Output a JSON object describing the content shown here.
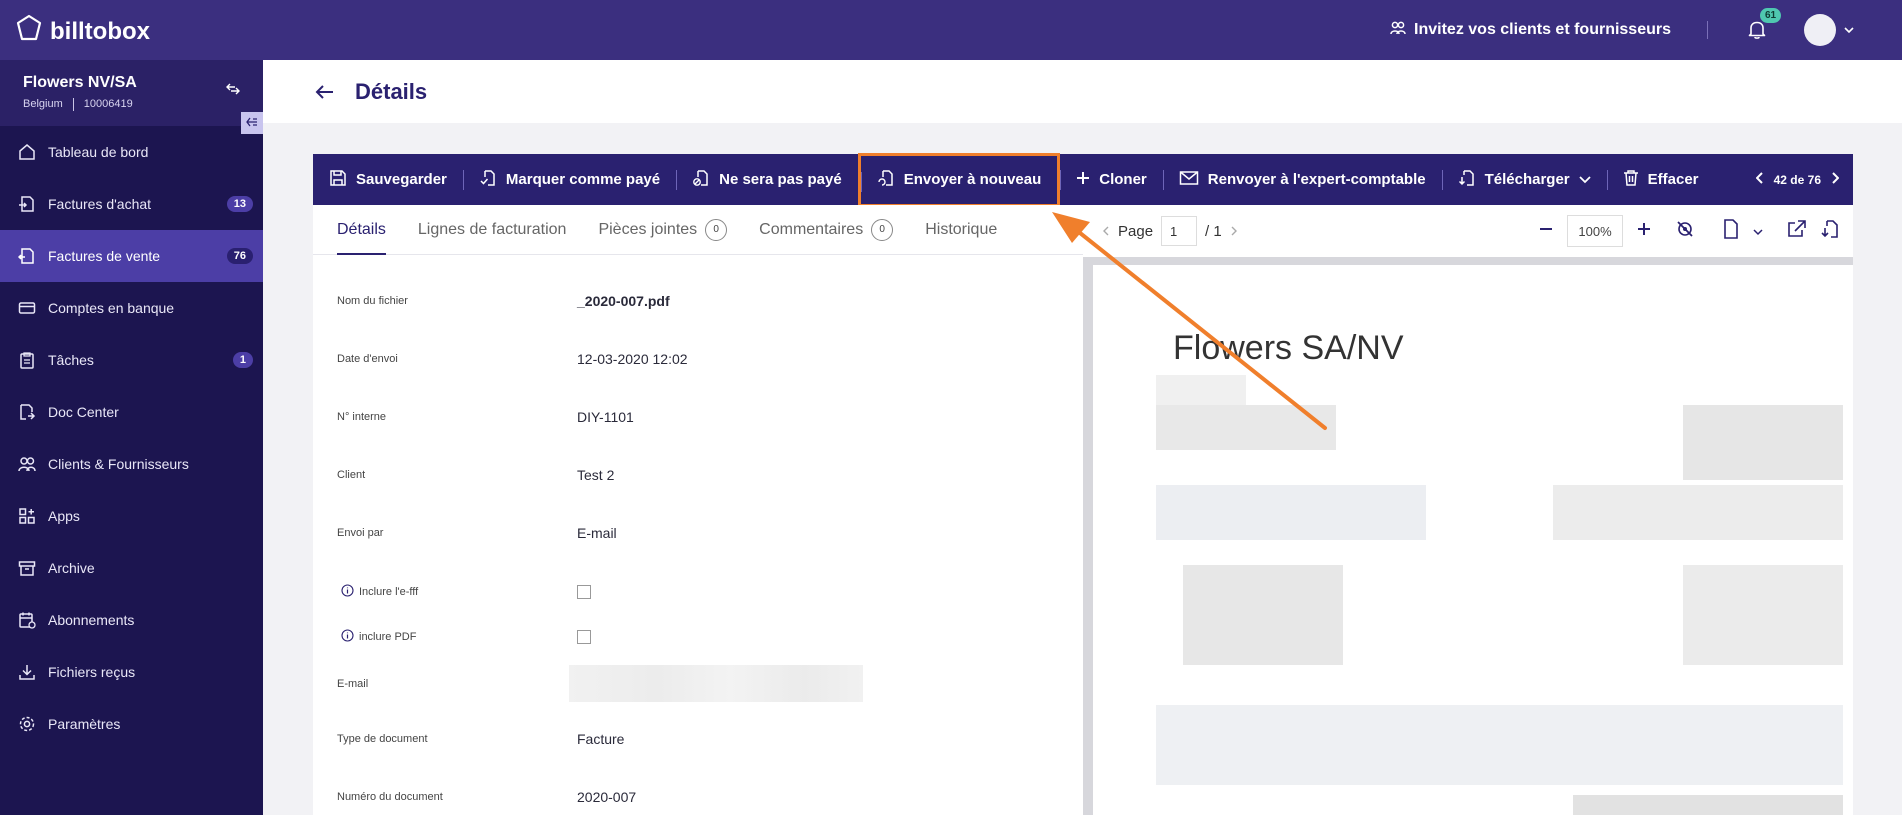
{
  "app": {
    "logo_text": "billtobox",
    "invite_label": "Invitez vos clients et fournisseurs",
    "notifications_count": "61"
  },
  "company": {
    "name": "Flowers NV/SA",
    "country": "Belgium",
    "id": "10006419"
  },
  "sidebar": {
    "items": [
      {
        "label": "Tableau de bord",
        "icon": "home-icon",
        "badge": ""
      },
      {
        "label": "Factures d'achat",
        "icon": "purchase-invoice-icon",
        "badge": "13"
      },
      {
        "label": "Factures de vente",
        "icon": "sales-invoice-icon",
        "badge": "76"
      },
      {
        "label": "Comptes en banque",
        "icon": "bank-card-icon",
        "badge": ""
      },
      {
        "label": "Tâches",
        "icon": "clipboard-icon",
        "badge": "1"
      },
      {
        "label": "Doc Center",
        "icon": "doc-center-icon",
        "badge": ""
      },
      {
        "label": "Clients & Fournisseurs",
        "icon": "users-icon",
        "badge": ""
      },
      {
        "label": "Apps",
        "icon": "apps-icon",
        "badge": ""
      },
      {
        "label": "Archive",
        "icon": "archive-icon",
        "badge": ""
      },
      {
        "label": "Abonnements",
        "icon": "subscription-icon",
        "badge": ""
      },
      {
        "label": "Fichiers reçus",
        "icon": "download-tray-icon",
        "badge": ""
      },
      {
        "label": "Paramètres",
        "icon": "gear-icon",
        "badge": ""
      }
    ]
  },
  "header": {
    "title": "Détails"
  },
  "toolbar": {
    "save": "Sauvegarder",
    "mark_paid": "Marquer comme payé",
    "not_paid": "Ne sera pas payé",
    "resend": "Envoyer à nouveau",
    "clone": "Cloner",
    "send_accountant": "Renvoyer à l'expert-comptable",
    "download": "Télécharger",
    "delete": "Effacer",
    "pager": "42 de 76"
  },
  "tabs": [
    {
      "label": "Détails",
      "count": ""
    },
    {
      "label": "Lignes de facturation",
      "count": ""
    },
    {
      "label": "Pièces jointes",
      "count": "0"
    },
    {
      "label": "Commentaires",
      "count": "0"
    },
    {
      "label": "Historique",
      "count": ""
    }
  ],
  "fields": {
    "filename_label": "Nom du fichier",
    "filename_value": "_2020-007.pdf",
    "sent_date_label": "Date d'envoi",
    "sent_date_value": "12-03-2020 12:02",
    "internal_no_label": "N° interne",
    "internal_no_value": "DIY-1101",
    "client_label": "Client",
    "client_value": "Test 2",
    "sent_by_label": "Envoi par",
    "sent_by_value": "E-mail",
    "include_efff_label": "Inclure l'e-fff",
    "include_pdf_label": "inclure PDF",
    "email_label": "E-mail",
    "doc_type_label": "Type de document",
    "doc_type_value": "Facture",
    "doc_number_label": "Numéro du document",
    "doc_number_value": "2020-007"
  },
  "viewer": {
    "page_label": "Page",
    "page_value": "1",
    "page_total": "/ 1",
    "zoom": "100%",
    "doc_title": "Flowers SA/NV"
  },
  "colors": {
    "topbar": "#3b2f7f",
    "sidebar": "#1c1550",
    "active_nav": "#4c3ea6",
    "toolbar": "#2a2170",
    "highlight": "#f07f2c"
  }
}
